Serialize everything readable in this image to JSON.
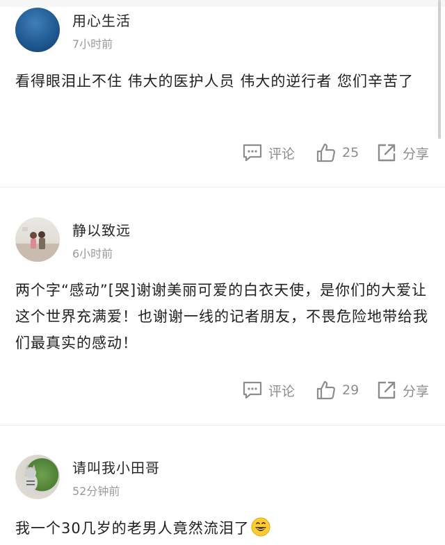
{
  "comments": [
    {
      "username": "用心生活",
      "time": "7小时前",
      "text": "看得眼泪止不住 伟大的医护人员 伟大的逆行者 您们辛苦了",
      "comment_label": "评论",
      "like_count": "25",
      "share_label": "分享",
      "avatar": "ocean-avatar"
    },
    {
      "username": "静以致远",
      "time": "6小时前",
      "text": "两个字“感动”[哭]谢谢美丽可爱的白衣天使，是你们的大爱让这个世界充满爱！也谢谢一线的记者朋友，不畏危险地带给我们最真实的感动！",
      "comment_label": "评论",
      "like_count": "29",
      "share_label": "分享",
      "avatar": "photo-avatar"
    },
    {
      "username": "请叫我小田哥",
      "time": "52分钟前",
      "text": "我一个30几岁的老男人竟然流泪了",
      "emoji": "grinning-face-emoji",
      "avatar": "plant-avatar"
    }
  ],
  "icons": {
    "comment": "comment-bubble-icon",
    "like": "thumbs-up-icon",
    "share": "share-arrow-icon"
  },
  "colors": {
    "text": "#1f1f1f",
    "meta": "#9a9a9a",
    "action": "#8c8c8c",
    "divider": "#ececec"
  }
}
